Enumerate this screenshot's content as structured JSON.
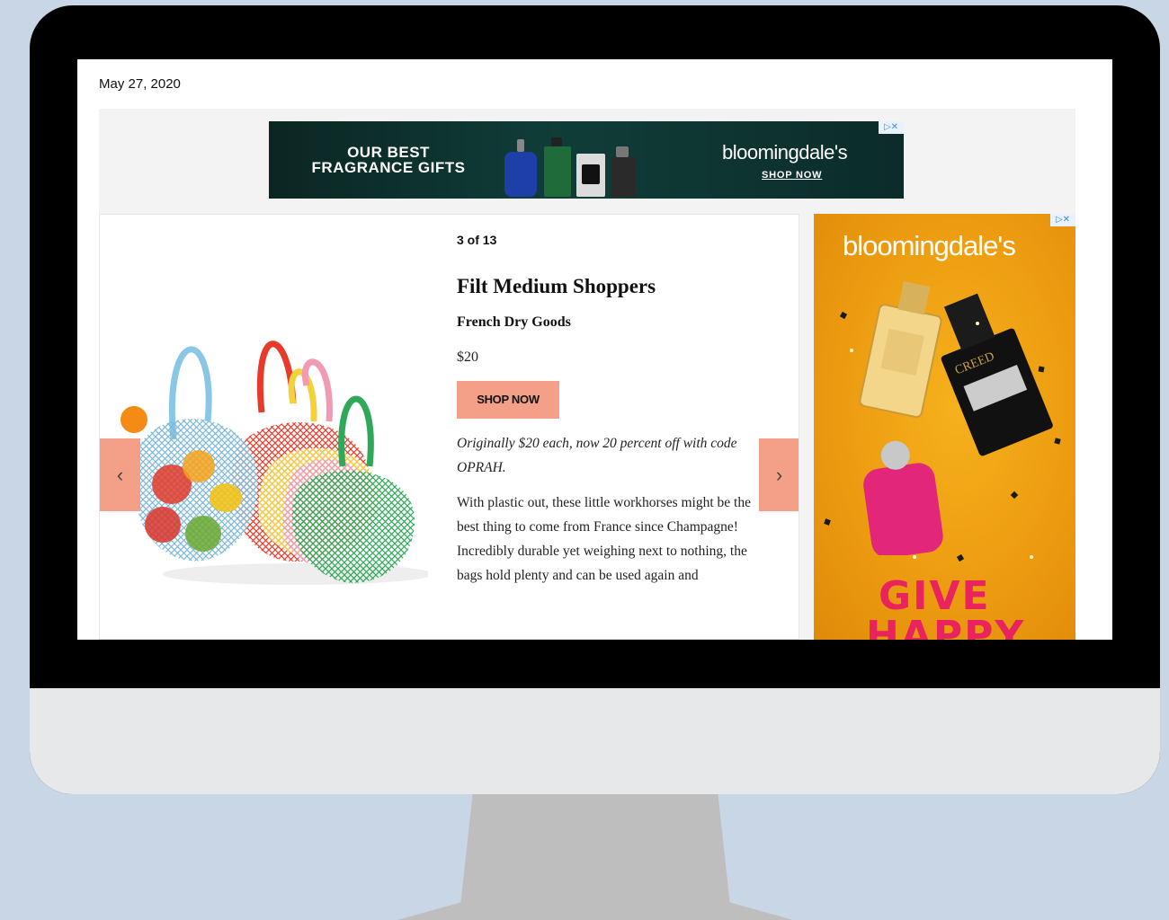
{
  "page": {
    "date": "May 27, 2020"
  },
  "banner_ad": {
    "headline": "OUR BEST FRAGRANCE GIFTS",
    "brand": "bloomingdale's",
    "cta": "SHOP NOW",
    "adchoices_icon": "adchoices-icon"
  },
  "slideshow": {
    "counter": "3 of 13",
    "prev_icon": "chevron-left-icon",
    "next_icon": "chevron-right-icon",
    "item": {
      "title": "Filt Medium Shoppers",
      "brand": "French Dry Goods",
      "price": "$20",
      "button_label": "SHOP NOW",
      "promo": "Originally $20 each, now 20 percent off with code OPRAH.",
      "description": "With plastic out, these little workhorses might be the best thing to come from France since Champagne! Incredibly durable yet weighing next to nothing, the bags hold plenty and can be used again and"
    }
  },
  "side_ad": {
    "brand": "bloomingdale's",
    "bottle_label": "CREED",
    "line1": "GIVE",
    "line2": "HAPPY",
    "adchoices_icon": "adchoices-icon"
  },
  "colors": {
    "accent": "#f4a088",
    "page_background": "#c8d6e6",
    "ad_orange": "#f6b11c",
    "banner_green": "#0b2623"
  }
}
